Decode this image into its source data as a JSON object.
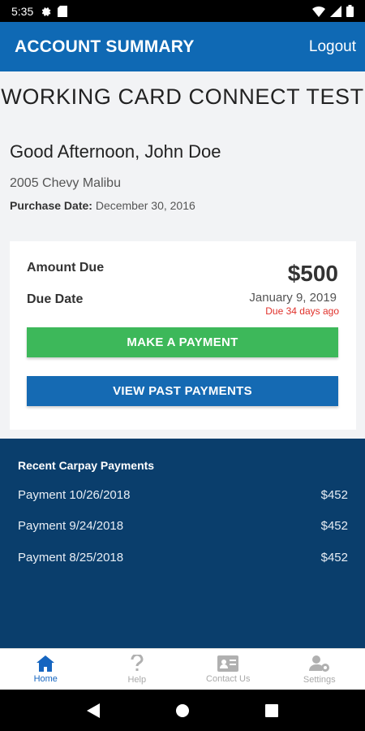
{
  "status": {
    "time": "5:35"
  },
  "header": {
    "title": "ACCOUNT SUMMARY",
    "logout_label": "Logout"
  },
  "store_name": "WORKING CARD CONNECT TEST",
  "greeting": "Good Afternoon, John Doe",
  "vehicle": "2005 Chevy Malibu",
  "purchase": {
    "label": "Purchase Date:",
    "value": "December 30, 2016"
  },
  "card": {
    "amount_label": "Amount Due",
    "amount_value": "$500",
    "due_label": "Due Date",
    "due_date": "January 9, 2019",
    "due_ago": "Due 34 days ago",
    "pay_button": "MAKE A PAYMENT",
    "past_button": "VIEW PAST PAYMENTS"
  },
  "recent": {
    "title": "Recent Carpay Payments",
    "payments": [
      {
        "label": "Payment 10/26/2018",
        "amount": "$452"
      },
      {
        "label": "Payment 9/24/2018",
        "amount": "$452"
      },
      {
        "label": "Payment 8/25/2018",
        "amount": "$452"
      }
    ]
  },
  "nav": {
    "items": [
      {
        "label": "Home",
        "icon": "home-icon"
      },
      {
        "label": "Help",
        "icon": "help-icon"
      },
      {
        "label": "Contact Us",
        "icon": "contact-card-icon"
      },
      {
        "label": "Settings",
        "icon": "user-settings-icon"
      }
    ]
  },
  "colors": {
    "primary": "#0f69b4",
    "success": "#3db85a",
    "dark_panel": "#0a3e6c",
    "alert": "#e0312b"
  }
}
